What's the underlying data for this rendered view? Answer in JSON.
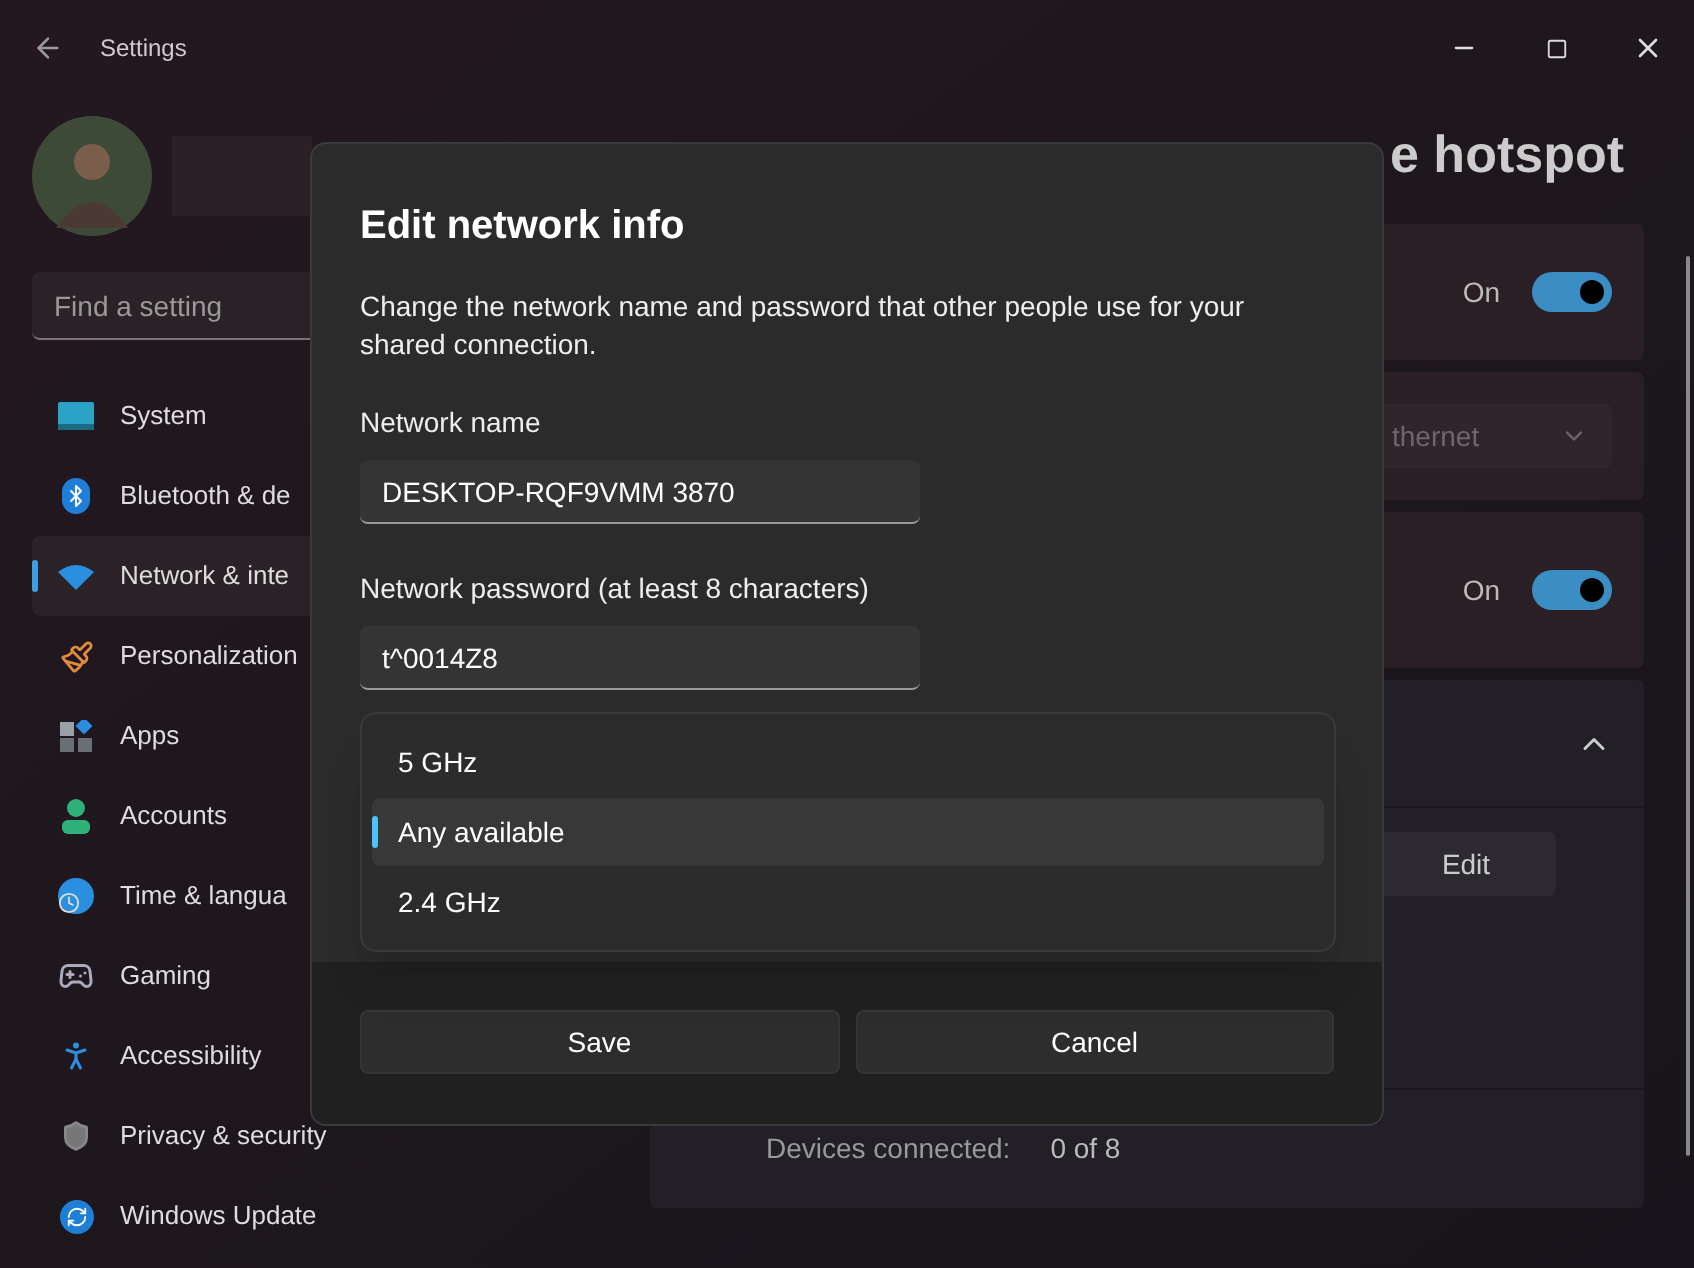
{
  "window": {
    "title": "Settings"
  },
  "search": {
    "placeholder": "Find a setting"
  },
  "sidebar": {
    "items": [
      {
        "label": "System",
        "kind": "system",
        "selected": false
      },
      {
        "label": "Bluetooth & de",
        "kind": "bluetooth",
        "selected": false
      },
      {
        "label": "Network & inte",
        "kind": "network",
        "selected": true
      },
      {
        "label": "Personalization",
        "kind": "brush",
        "selected": false
      },
      {
        "label": "Apps",
        "kind": "apps",
        "selected": false
      },
      {
        "label": "Accounts",
        "kind": "person",
        "selected": false
      },
      {
        "label": "Time & langua",
        "kind": "time",
        "selected": false
      },
      {
        "label": "Gaming",
        "kind": "gaming",
        "selected": false
      },
      {
        "label": "Accessibility",
        "kind": "accessibility",
        "selected": false
      },
      {
        "label": "Privacy & security",
        "kind": "shield",
        "selected": false
      },
      {
        "label": "Windows Update",
        "kind": "update",
        "selected": false
      }
    ]
  },
  "page": {
    "title": "e hotspot",
    "cards": [
      {
        "kind": "toggle",
        "value": "On",
        "on": true
      },
      {
        "kind": "dropdown",
        "value": "thernet"
      },
      {
        "kind": "toggle",
        "value": "On",
        "on": true
      },
      {
        "kind": "expander",
        "expanded": true,
        "button": "Edit",
        "label": "Devices connected:",
        "value": "0 of 8"
      }
    ]
  },
  "dialog": {
    "title": "Edit network info",
    "description": "Change the network name and password that other people use for your shared connection.",
    "fields": [
      {
        "label": "Network name",
        "value": "DESKTOP-RQF9VMM 3870"
      },
      {
        "label": "Network password (at least 8 characters)",
        "value": "t^0014Z8"
      }
    ],
    "band_options": [
      {
        "label": "5 GHz",
        "selected": false
      },
      {
        "label": "Any available",
        "selected": true
      },
      {
        "label": "2.4 GHz",
        "selected": false
      }
    ],
    "buttons": [
      "Save",
      "Cancel"
    ]
  }
}
